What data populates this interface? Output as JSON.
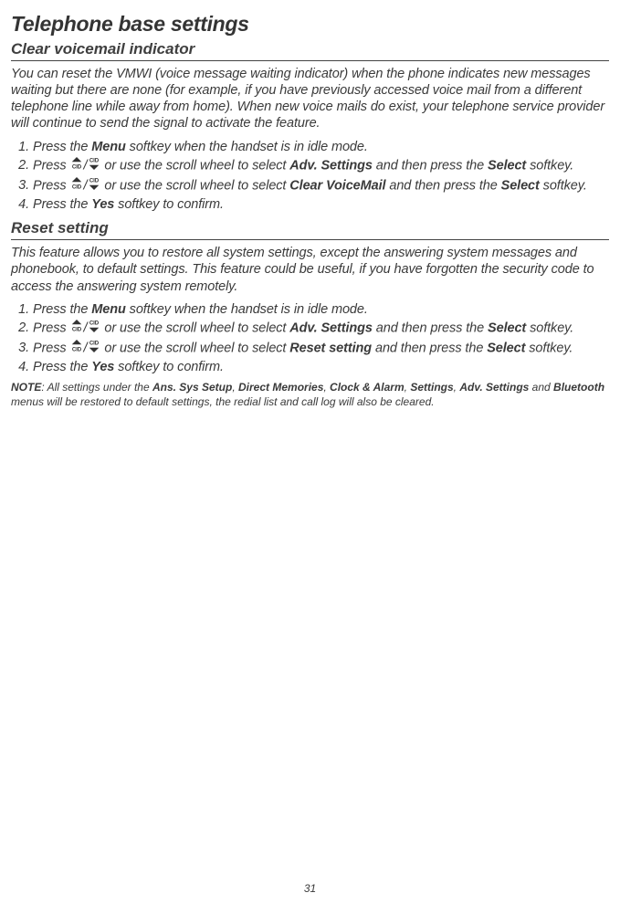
{
  "page_title": "Telephone base settings",
  "section1": {
    "title": "Clear voicemail indicator",
    "body": "You can reset the VMWI (voice message waiting indicator) when the phone indicates new messages waiting but there are none (for example, if you have previously accessed voice mail from a different telephone line while away from home). When new voice mails do exist, your telephone service provider will continue to send the signal to activate the feature.",
    "steps": {
      "1_pre": "Press the ",
      "1_bold": "Menu",
      "1_post": " softkey when the handset is in idle mode.",
      "2_pre": "Press ",
      "2_mid": " or use the scroll wheel to select ",
      "2_bold": "Adv. Settings",
      "2_post": " and then press the ",
      "2_bold2": "Select",
      "2_end": " softkey.",
      "3_pre": "Press ",
      "3_mid": " or use the scroll wheel to select ",
      "3_bold": "Clear VoiceMail",
      "3_post": " and then press the ",
      "3_bold2": "Select",
      "3_end": " softkey.",
      "4_pre": "Press the ",
      "4_bold": "Yes",
      "4_post": " softkey to confirm."
    }
  },
  "section2": {
    "title": "Reset setting",
    "body": "This feature allows you to restore all system settings, except the answering system messages and phonebook, to default settings. This feature could be useful, if you have forgotten the security code to access the answering system remotely.",
    "steps": {
      "1_pre": "Press the ",
      "1_bold": "Menu",
      "1_post": " softkey when the handset is in idle mode.",
      "2_pre": "Press ",
      "2_mid": " or use the scroll wheel to select ",
      "2_bold": "Adv. Settings",
      "2_post": " and then press the ",
      "2_bold2": "Select",
      "2_end": " softkey.",
      "3_pre": "Press ",
      "3_mid": " or use the scroll wheel to select ",
      "3_bold": "Reset setting",
      "3_post": " and then press the ",
      "3_bold2": "Select",
      "3_end": " softkey.",
      "4_pre": "Press the ",
      "4_bold": "Yes",
      "4_post": " softkey to confirm."
    }
  },
  "note": {
    "lead": "NOTE",
    "t1": ": All settings under the ",
    "b1": "Ans. Sys Setup",
    "t2": ", ",
    "b2": "Direct Memories",
    "t3": ", ",
    "b3": "Clock & Alarm",
    "t4": ", ",
    "b4": "Settings",
    "t5": ", ",
    "b5": "Adv. Settings",
    "t6": " and ",
    "b6": "Bluetooth",
    "t7": " menus will be restored to default settings, the redial list and call log will also be cleared."
  },
  "page_number": "31"
}
